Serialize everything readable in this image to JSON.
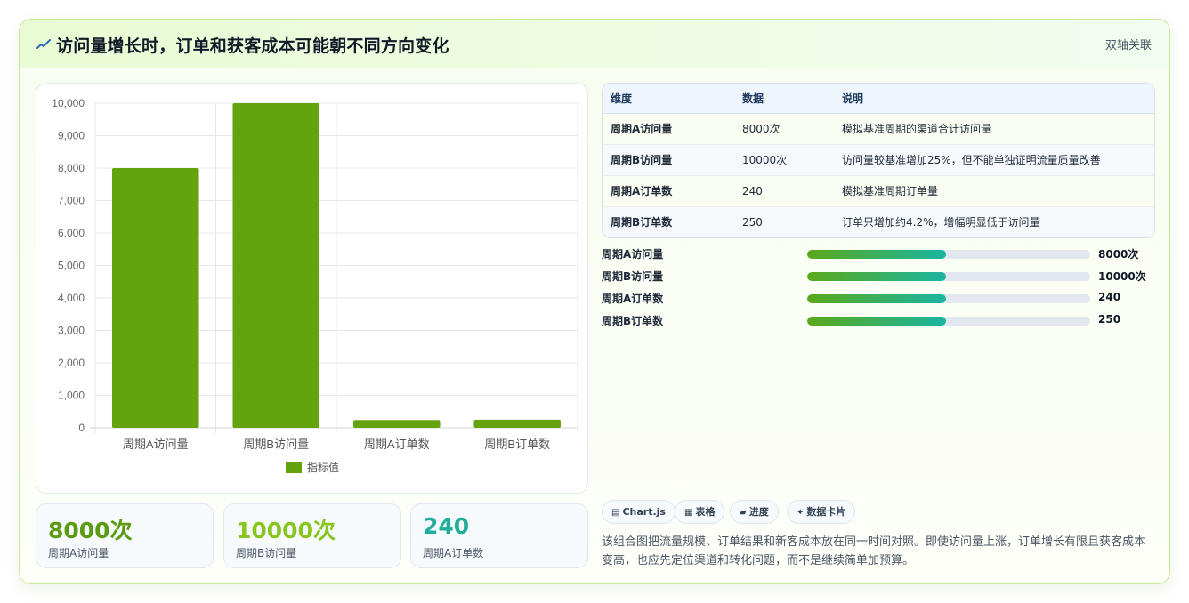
{
  "header": {
    "title": "访问量增长时，订单和获客成本可能朝不同方向变化",
    "badge": "双轴关联"
  },
  "chart_data": {
    "type": "bar",
    "categories": [
      "周期A访问量",
      "周期B访问量",
      "周期A订单数",
      "周期B订单数"
    ],
    "series": [
      {
        "name": "指标值",
        "values": [
          8000,
          10000,
          240,
          250
        ]
      }
    ],
    "ylim": [
      0,
      10000
    ],
    "yticks": [
      "10,000",
      "9,000",
      "8,000",
      "7,000",
      "6,000",
      "5,000",
      "4,000",
      "3,000",
      "2,000",
      "1,000",
      "0"
    ],
    "grid": true,
    "legend_position": "bottom",
    "color": "#62a30e"
  },
  "table": {
    "headers": [
      "维度",
      "数据",
      "说明"
    ],
    "rows": [
      [
        "周期A访问量",
        "8000次",
        "模拟基准周期的渠道合计访问量"
      ],
      [
        "周期B访问量",
        "10000次",
        "访问量较基准增加25%，但不能单独证明流量质量改善"
      ],
      [
        "周期A订单数",
        "240",
        "模拟基准周期订单量"
      ],
      [
        "周期B订单数",
        "250",
        "订单只增加约4.2%，增幅明显低于访问量"
      ]
    ]
  },
  "progress": [
    {
      "label": "周期A访问量",
      "value": "8000次",
      "fill": 0.49
    },
    {
      "label": "周期B访问量",
      "value": "10000次",
      "fill": 0.49
    },
    {
      "label": "周期A订单数",
      "value": "240",
      "fill": 0.49
    },
    {
      "label": "周期B订单数",
      "value": "250",
      "fill": 0.49
    }
  ],
  "stats": [
    {
      "value": "8000次",
      "label": "周期A访问量",
      "color": "#5a9b12"
    },
    {
      "value": "10000次",
      "label": "周期B访问量",
      "color": "#86c61f"
    },
    {
      "value": "240",
      "label": "周期A订单数",
      "color": "#1fae9a"
    }
  ],
  "chips": [
    {
      "icon": "chart-icon",
      "glyph": "▤",
      "label": "Chart.js"
    },
    {
      "icon": "table-icon",
      "glyph": "▦",
      "label": "表格"
    },
    {
      "icon": "progress-icon",
      "glyph": "▰",
      "label": "进度"
    },
    {
      "icon": "sparkle-icon",
      "glyph": "✦",
      "label": "数据卡片"
    }
  ],
  "description": "该组合图把流量规模、订单结果和新客成本放在同一时间对照。即使访问量上涨，订单增长有限且获客成本变高，也应先定位渠道和转化问题，而不是继续简单加预算。"
}
